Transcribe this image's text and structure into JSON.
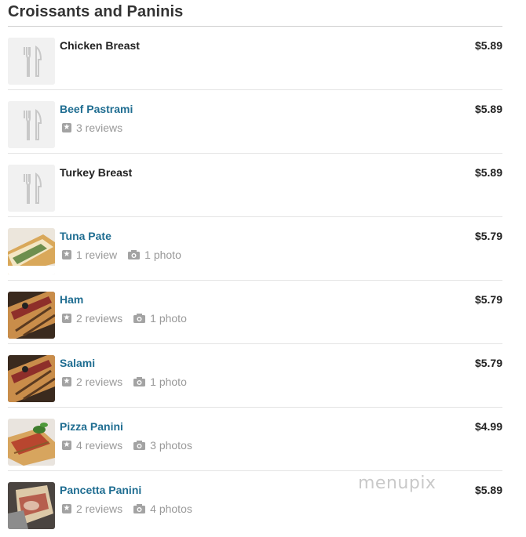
{
  "section": {
    "title": "Croissants and Paninis"
  },
  "items": [
    {
      "name": "Chicken Breast",
      "price": "$5.89",
      "linked": false,
      "reviews": "",
      "photos": "",
      "image": "placeholder-utensils-icon"
    },
    {
      "name": "Beef Pastrami",
      "price": "$5.89",
      "linked": true,
      "reviews": "3 reviews",
      "photos": "",
      "image": "placeholder-utensils-icon"
    },
    {
      "name": "Turkey Breast",
      "price": "$5.89",
      "linked": false,
      "reviews": "",
      "photos": "",
      "image": "placeholder-utensils-icon"
    },
    {
      "name": "Tuna Pate",
      "price": "$5.79",
      "linked": true,
      "reviews": "1 review",
      "photos": "1 photo",
      "image": "sandwich-photo"
    },
    {
      "name": "Ham",
      "price": "$5.79",
      "linked": true,
      "reviews": "2 reviews",
      "photos": "1 photo",
      "image": "panini-photo"
    },
    {
      "name": "Salami",
      "price": "$5.79",
      "linked": true,
      "reviews": "2 reviews",
      "photos": "1 photo",
      "image": "panini-photo"
    },
    {
      "name": "Pizza Panini",
      "price": "$4.99",
      "linked": true,
      "reviews": "4 reviews",
      "photos": "3 photos",
      "image": "pizza-panini-photo"
    },
    {
      "name": "Pancetta Panini",
      "price": "$5.89",
      "linked": true,
      "reviews": "2 reviews",
      "photos": "4 photos",
      "image": "pancetta-panini-photo"
    }
  ],
  "watermark": "menupix",
  "colors": {
    "link": "#1f6d91",
    "meta": "#999999",
    "price": "#222222"
  }
}
